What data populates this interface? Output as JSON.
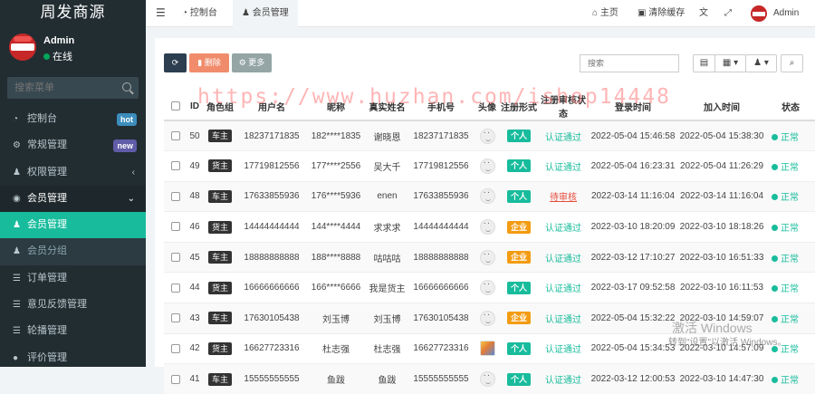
{
  "brand": "周发商源",
  "user": {
    "name": "Admin",
    "status": "在线"
  },
  "sidebar_search": {
    "placeholder": "搜索菜单"
  },
  "menu": [
    {
      "label": "控制台",
      "icon": "dashboard-icon",
      "badge": "hot",
      "badge_color": "#3c8dbc"
    },
    {
      "label": "常规管理",
      "icon": "cogs-icon",
      "badge": "new",
      "badge_color": "#605ca8"
    },
    {
      "label": "权限管理",
      "icon": "group-icon",
      "arrow": "‹"
    },
    {
      "label": "会员管理",
      "icon": "user-circle-icon",
      "arrow": "⌄"
    },
    {
      "label": "会员管理",
      "icon": "user-icon",
      "active": true
    },
    {
      "label": "会员分组",
      "icon": "users-icon"
    },
    {
      "label": "订单管理",
      "icon": "list-icon"
    },
    {
      "label": "意见反馈管理",
      "icon": "list-icon"
    },
    {
      "label": "轮播管理",
      "icon": "list-icon"
    },
    {
      "label": "评价管理",
      "icon": "comment-icon"
    }
  ],
  "topbar": {
    "tabs": [
      "控制台",
      "会员管理"
    ],
    "home": "主页",
    "clear_cache": "清除缓存",
    "admin": "Admin"
  },
  "toolbar": {
    "delete": "删除",
    "more": "更多",
    "search_placeholder": "搜索"
  },
  "table": {
    "headers": [
      "ID",
      "角色组",
      "用户名",
      "昵称",
      "真实姓名",
      "手机号",
      "头像",
      "注册形式",
      "注册审核状态",
      "登录时间",
      "加入时间",
      "状态"
    ],
    "rows": [
      {
        "id": "50",
        "role": "车主",
        "username": "18237171835",
        "nickname": "182****1835",
        "realname": "谢晓恩",
        "phone": "18237171835",
        "avatar": "default",
        "reg": "个人",
        "reg_color": "green",
        "audit": "认证通过",
        "login": "2022-05-04 15:46:58",
        "join": "2022-05-04 15:38:30",
        "status": "正常"
      },
      {
        "id": "49",
        "role": "货主",
        "username": "17719812556",
        "nickname": "177****2556",
        "realname": "吴大千",
        "phone": "17719812556",
        "avatar": "default",
        "reg": "个人",
        "reg_color": "green",
        "audit": "认证通过",
        "login": "2022-05-04 16:23:31",
        "join": "2022-05-04 11:26:29",
        "status": "正常"
      },
      {
        "id": "48",
        "role": "车主",
        "username": "17633855936",
        "nickname": "176****5936",
        "realname": "enen",
        "phone": "17633855936",
        "avatar": "default",
        "reg": "个人",
        "reg_color": "green",
        "audit": "待审核",
        "login": "2022-03-14 11:16:04",
        "join": "2022-03-14 11:16:04",
        "status": "正常"
      },
      {
        "id": "46",
        "role": "货主",
        "username": "14444444444",
        "nickname": "144****4444",
        "realname": "求求求",
        "phone": "14444444444",
        "avatar": "default",
        "reg": "企业",
        "reg_color": "orange",
        "audit": "认证通过",
        "login": "2022-03-10 18:20:09",
        "join": "2022-03-10 18:18:26",
        "status": "正常"
      },
      {
        "id": "45",
        "role": "车主",
        "username": "18888888888",
        "nickname": "188****8888",
        "realname": "咕咕咕",
        "phone": "18888888888",
        "avatar": "default",
        "reg": "企业",
        "reg_color": "orange",
        "audit": "认证通过",
        "login": "2022-03-12 17:10:27",
        "join": "2022-03-10 16:51:33",
        "status": "正常"
      },
      {
        "id": "44",
        "role": "货主",
        "username": "16666666666",
        "nickname": "166****6666",
        "realname": "我是货主",
        "phone": "16666666666",
        "avatar": "default",
        "reg": "个人",
        "reg_color": "green",
        "audit": "认证通过",
        "login": "2022-03-17 09:52:58",
        "join": "2022-03-10 16:11:53",
        "status": "正常"
      },
      {
        "id": "43",
        "role": "车主",
        "username": "17630105438",
        "nickname": "刘玉博",
        "realname": "刘玉博",
        "phone": "17630105438",
        "avatar": "default",
        "reg": "企业",
        "reg_color": "orange",
        "audit": "认证通过",
        "login": "2022-05-04 15:32:22",
        "join": "2022-03-10 14:59:07",
        "status": "正常"
      },
      {
        "id": "42",
        "role": "货主",
        "username": "16627723316",
        "nickname": "杜志强",
        "realname": "杜志强",
        "phone": "16627723316",
        "avatar": "photo",
        "reg": "个人",
        "reg_color": "green",
        "audit": "认证通过",
        "login": "2022-05-04 15:34:53",
        "join": "2022-03-10 14:57:09",
        "status": "正常"
      },
      {
        "id": "41",
        "role": "车主",
        "username": "15555555555",
        "nickname": "鱼跋",
        "realname": "鱼跋",
        "phone": "15555555555",
        "avatar": "default",
        "reg": "个人",
        "reg_color": "green",
        "audit": "认证通过",
        "login": "2022-03-12 12:00:53",
        "join": "2022-03-10 14:47:30",
        "status": "正常"
      }
    ]
  },
  "watermark": "https://www.huzhan.com/ishop14448",
  "windows_activation": {
    "title": "激活 Windows",
    "subtitle": "转到\"设置\"以激活 Windows。"
  }
}
